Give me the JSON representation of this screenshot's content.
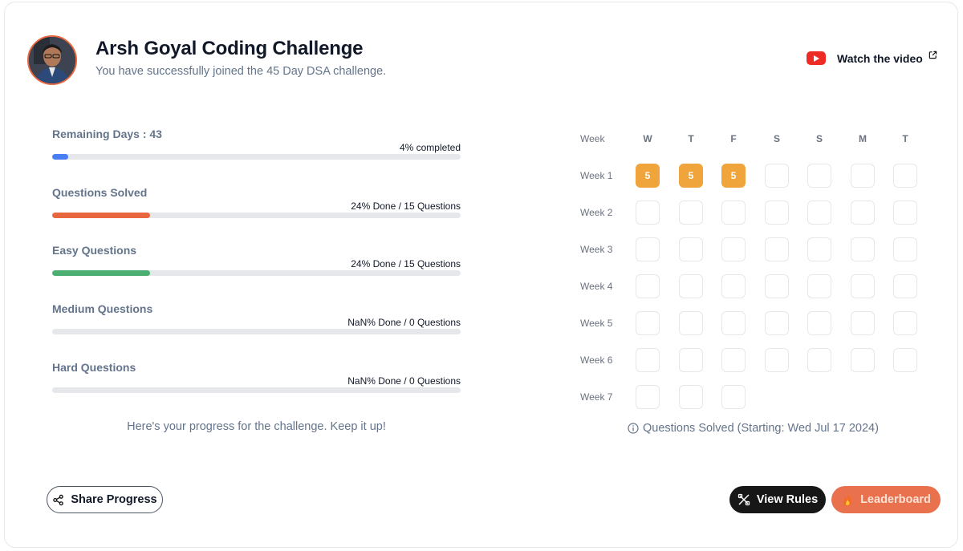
{
  "header": {
    "title": "Arsh Goyal Coding Challenge",
    "subtitle": "You have successfully joined the 45 Day DSA challenge.",
    "watch_label": "Watch the video"
  },
  "stats": [
    {
      "label": "Remaining Days : 43",
      "right": "4% completed",
      "progress": 0.04,
      "color": "#4a7ef6"
    },
    {
      "label": "Questions Solved",
      "right": "24% Done / 15 Questions",
      "progress": 0.24,
      "color": "#e8673f"
    },
    {
      "label": "Easy Questions",
      "right": "24% Done / 15 Questions",
      "progress": 0.24,
      "color": "#4caf72"
    },
    {
      "label": "Medium Questions",
      "right": "NaN% Done / 0 Questions",
      "progress": 0,
      "color": "#f0a43c"
    },
    {
      "label": "Hard Questions",
      "right": "NaN% Done / 0 Questions",
      "progress": 0,
      "color": "#e5484d"
    }
  ],
  "progress_note": "Here's your progress for the challenge. Keep it up!",
  "calendar": {
    "week_header": "Week",
    "days": [
      "W",
      "T",
      "F",
      "S",
      "S",
      "M",
      "T"
    ],
    "weeks": [
      {
        "label": "Week 1",
        "cells": [
          "5",
          "5",
          "5",
          "",
          "",
          "",
          ""
        ]
      },
      {
        "label": "Week 2",
        "cells": [
          "",
          "",
          "",
          "",
          "",
          "",
          ""
        ]
      },
      {
        "label": "Week 3",
        "cells": [
          "",
          "",
          "",
          "",
          "",
          "",
          ""
        ]
      },
      {
        "label": "Week 4",
        "cells": [
          "",
          "",
          "",
          "",
          "",
          "",
          ""
        ]
      },
      {
        "label": "Week 5",
        "cells": [
          "",
          "",
          "",
          "",
          "",
          "",
          ""
        ]
      },
      {
        "label": "Week 6",
        "cells": [
          "",
          "",
          "",
          "",
          "",
          "",
          ""
        ]
      },
      {
        "label": "Week 7",
        "cells": [
          "",
          "",
          ""
        ]
      }
    ],
    "note": "Questions Solved (Starting: Wed Jul 17 2024)",
    "filled_color": "#f0a43c"
  },
  "buttons": {
    "share": "Share Progress",
    "rules": "View Rules",
    "leaderboard": "Leaderboard"
  },
  "colors": {
    "accent": "#e8673f",
    "youtube": "#ee2b24"
  }
}
